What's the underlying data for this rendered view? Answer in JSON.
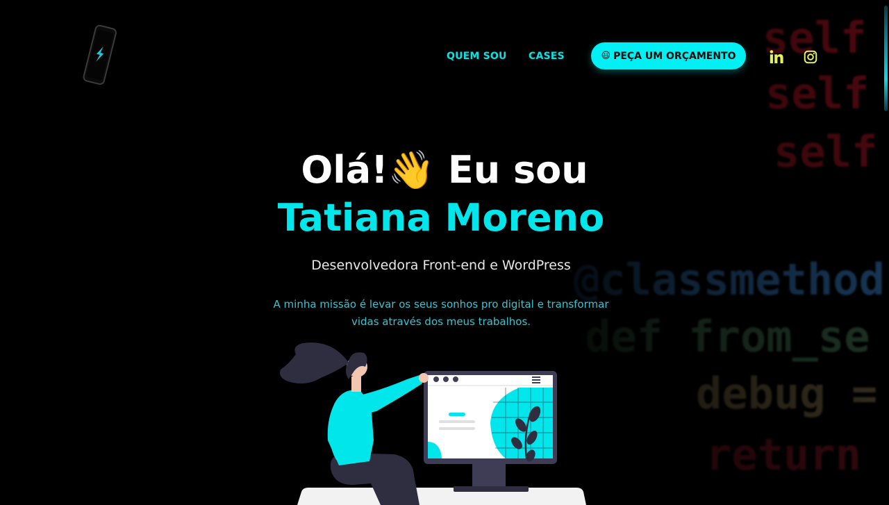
{
  "background": {
    "code_lines": [
      "self",
      "self",
      "self",
      "@classmethod",
      "def from_se",
      "debug =",
      "return"
    ]
  },
  "nav": {
    "links": [
      {
        "label": "QUEM SOU"
      },
      {
        "label": "CASES"
      }
    ],
    "cta": {
      "emoji": "😃",
      "label": "PEÇA UM ORÇAMENTO"
    },
    "social": [
      {
        "icon": "linkedin-icon"
      },
      {
        "icon": "instagram-icon"
      }
    ]
  },
  "hero": {
    "greeting_before": "Olá!",
    "wave_emoji": "👋",
    "greeting_after": " Eu sou",
    "name": "Tatiana Moreno",
    "subtitle": "Desenvolvedora Front-end e WordPress",
    "mission_line1": "A minha missão é levar os seus sonhos pro digital e transformar",
    "mission_line2": "vidas através dos meus trabalhos."
  },
  "colors": {
    "accent": "#00E6EA",
    "social_icon": "#E4F15A",
    "background": "#000000"
  }
}
